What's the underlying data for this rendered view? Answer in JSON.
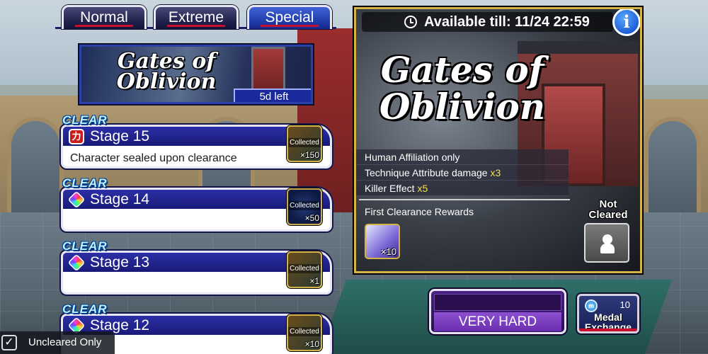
{
  "tabs": [
    {
      "label": "Normal",
      "active": false
    },
    {
      "label": "Extreme",
      "active": false
    },
    {
      "label": "Special",
      "active": true
    }
  ],
  "event_banner": {
    "title_line1": "Gates of",
    "title_line2": "Oblivion",
    "days_left": "5d left"
  },
  "stages": [
    {
      "clear_label": "CLEAR",
      "badge": "power",
      "badge_text": "力",
      "name": "Stage 15",
      "description": "Character sealed upon clearance",
      "reward_label": "Collected",
      "reward_qty": "×150"
    },
    {
      "clear_label": "CLEAR",
      "badge": "rainbow",
      "badge_text": "",
      "name": "Stage 14",
      "description": "",
      "reward_label": "Collected",
      "reward_qty": "×50"
    },
    {
      "clear_label": "CLEAR",
      "badge": "rainbow",
      "badge_text": "",
      "name": "Stage 13",
      "description": "",
      "reward_label": "Collected",
      "reward_qty": "×1"
    },
    {
      "clear_label": "CLEAR",
      "badge": "rainbow",
      "badge_text": "",
      "name": "Stage 12",
      "description": "",
      "reward_label": "Collected",
      "reward_qty": "×10"
    }
  ],
  "filter": {
    "label": "Uncleared Only",
    "checked": true,
    "check_glyph": "✓"
  },
  "detail": {
    "available_label": "Available till: 11/24 22:59",
    "info_glyph": "i",
    "title_line1": "Gates of",
    "title_line2": "Oblivion",
    "conditions": [
      {
        "text": "Human Affiliation only",
        "mult": ""
      },
      {
        "text": "Technique Attribute damage ",
        "mult": "x3"
      },
      {
        "text": "Killer Effect ",
        "mult": "x5"
      }
    ],
    "first_clear_label": "First Clearance Rewards",
    "first_reward_qty": "×10",
    "not_cleared_line1": "Not",
    "not_cleared_line2": "Cleared"
  },
  "difficulty": {
    "label": "VERY HARD"
  },
  "medal_exchange": {
    "count": "10",
    "coin_glyph": "m",
    "line1": "Medal",
    "line2": "Exchange"
  },
  "colors": {
    "accent_red": "#c8102e",
    "tab_active": "#1f3aa6",
    "gold_border": "#d6b347",
    "multiplier": "#f5e04a"
  }
}
